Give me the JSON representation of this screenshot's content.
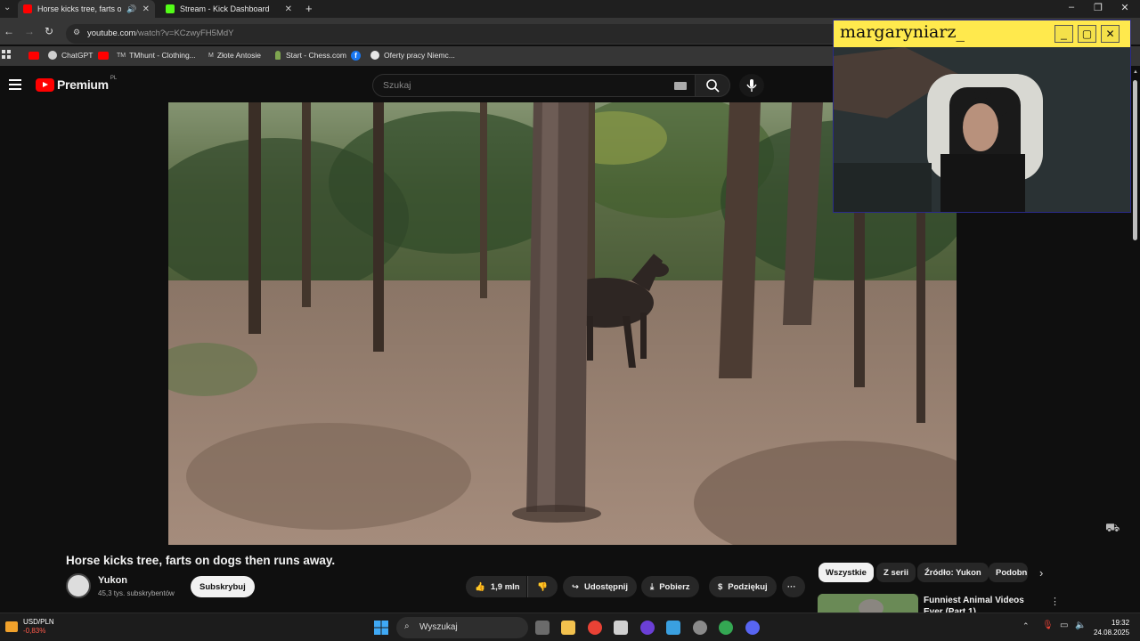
{
  "browser": {
    "tabs": [
      {
        "label": "Horse kicks tree, farts on d",
        "active": true,
        "favicon_color": "#ff0000"
      },
      {
        "label": "Stream - Kick Dashboard",
        "active": false,
        "favicon_color": "#53fc18"
      }
    ],
    "new_tab": "+",
    "url_host": "youtube.com",
    "url_path": "/watch?v=KCzwyFH5MdY"
  },
  "bookmarks": [
    {
      "label": "ChatGPT",
      "color": "#dddddd"
    },
    {
      "label": "TMhunt - Clothing...",
      "color": "#dddddd"
    },
    {
      "label": "Złote Antosie",
      "color": "#dddddd"
    },
    {
      "label": "Start - Chess.com",
      "color": "#7fa650"
    },
    {
      "label": "Oferty pracy Niemc...",
      "color": "#dddddd"
    }
  ],
  "youtube": {
    "logo_text": "Premium",
    "logo_region": "PL",
    "search_placeholder": "Szukaj"
  },
  "webcam": {
    "title": "margaryniarz_"
  },
  "video": {
    "title": "Horse kicks tree, farts on dogs then runs away.",
    "channel": "Yukon",
    "subscribers": "45,3 tys. subskrybentów",
    "subscribe_label": "Subskrybuj",
    "likes": "1,9 mln",
    "share_label": "Udostępnij",
    "download_label": "Pobierz",
    "thanks_label": "Podziękuj",
    "more_label": "···"
  },
  "chips": [
    {
      "label": "Wszystkie",
      "selected": true
    },
    {
      "label": "Z serii",
      "selected": false
    },
    {
      "label": "Źródło: Yukon",
      "selected": false
    },
    {
      "label": "Podobn",
      "selected": false
    }
  ],
  "recommendation": {
    "title": "Funniest Animal Videos Ever (Part 1)"
  },
  "taskbar": {
    "ticker_label": "USD/PLN",
    "ticker_change": "-0,83%",
    "search_label": "Wyszukaj",
    "time": "19:32",
    "date": "24.08.2025"
  }
}
